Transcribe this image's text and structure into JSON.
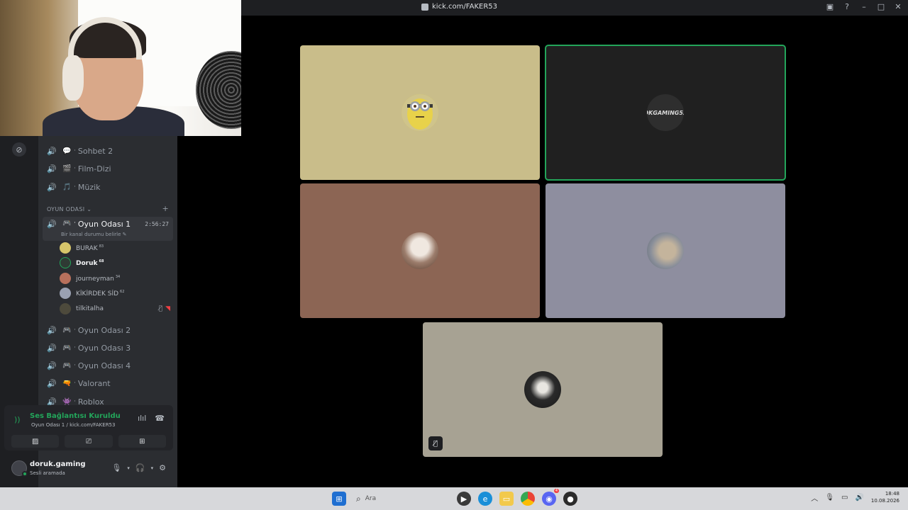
{
  "window": {
    "title": "kick.com/FAKER53"
  },
  "sidebar": {
    "top_channels": [
      {
        "label": "Sohbet 2",
        "emoji": "💬"
      },
      {
        "label": "Film-Dizi",
        "emoji": "🎬"
      },
      {
        "label": "Müzik",
        "emoji": "🎵"
      }
    ],
    "category": {
      "label": "OYUN ODASI",
      "chevron": "⌄",
      "plus": "+"
    },
    "active_channel": {
      "label": "Oyun Odası 1",
      "timer": "2:56:27",
      "status_hint": "Bir kanal durumu belirle"
    },
    "members": [
      {
        "name": "BURAK",
        "sup": "83"
      },
      {
        "name": "Doruk",
        "sup": "68"
      },
      {
        "name": "journeyman",
        "sup": "34"
      },
      {
        "name": "KİKİRDEK SİD",
        "sup": "62"
      },
      {
        "name": "tilkitalha",
        "sup": ""
      }
    ],
    "other_channels": [
      {
        "label": "Oyun Odası 2",
        "emoji": "🎮"
      },
      {
        "label": "Oyun Odası 3",
        "emoji": "🎮"
      },
      {
        "label": "Oyun Odası 4",
        "emoji": "🎮"
      },
      {
        "label": "Valorant",
        "emoji": "🔫"
      },
      {
        "label": "Roblox",
        "emoji": "👾"
      }
    ]
  },
  "voice_panel": {
    "status": "Ses Bağlantısı Kuruldu",
    "path": "Oyun Odası 1 / kick.com/FAKER53"
  },
  "user_panel": {
    "username": "doruk.gaming",
    "status": "Sesli aramada"
  },
  "tiles": [
    {
      "avatar_label": "",
      "bg": "#c9bd8a"
    },
    {
      "avatar_label": "DKGAMING53",
      "bg": "#202020"
    },
    {
      "avatar_label": "",
      "bg": "#8c6554"
    },
    {
      "avatar_label": "",
      "bg": "#8e8e9f"
    },
    {
      "avatar_label": "",
      "bg": "#a7a293"
    }
  ],
  "taskbar": {
    "search_placeholder": "Ara",
    "time": "18:48",
    "date": "10.08.2026",
    "discord_badge": "4"
  },
  "colors": {
    "speaking": "#23a55a",
    "sidebar_bg": "#2b2d31",
    "titlebar_bg": "#1e1f22"
  }
}
